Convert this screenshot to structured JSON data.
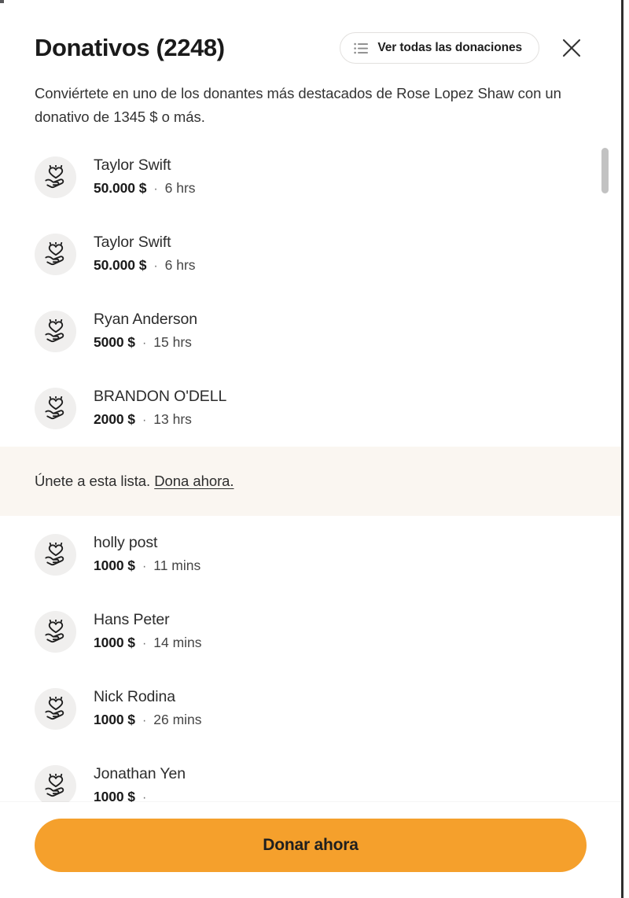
{
  "header": {
    "title": "Donativos (2248)",
    "view_all_label": "Ver todas las donaciones",
    "view_all_icon": "list-icon",
    "close_icon": "close-icon",
    "subtitle": "Conviértete en uno de los donantes más destacados de Rose Lopez Shaw con un donativo de 1345 $ o más."
  },
  "donations": [
    {
      "name": "Taylor Swift",
      "amount": "50.000 $",
      "separator": "·",
      "time": "6 hrs",
      "avatar_icon": "heart-hand-icon"
    },
    {
      "name": "Taylor Swift",
      "amount": "50.000 $",
      "separator": "·",
      "time": "6 hrs",
      "avatar_icon": "heart-hand-icon"
    },
    {
      "name": "Ryan Anderson",
      "amount": "5000 $",
      "separator": "·",
      "time": "15 hrs",
      "avatar_icon": "heart-hand-icon"
    },
    {
      "name": "BRANDON O'DELL",
      "amount": "2000 $",
      "separator": "·",
      "time": "13 hrs",
      "avatar_icon": "heart-hand-icon"
    }
  ],
  "join_banner": {
    "text": "Únete a esta lista.",
    "link_label": "Dona ahora."
  },
  "donations_after": [
    {
      "name": "holly post",
      "amount": "1000 $",
      "separator": "·",
      "time": "11 mins",
      "avatar_icon": "heart-hand-icon"
    },
    {
      "name": "Hans Peter",
      "amount": "1000 $",
      "separator": "·",
      "time": "14 mins",
      "avatar_icon": "heart-hand-icon"
    },
    {
      "name": "Nick Rodina",
      "amount": "1000 $",
      "separator": "·",
      "time": "26 mins",
      "avatar_icon": "heart-hand-icon"
    },
    {
      "name": "Jonathan Yen",
      "amount": "1000 $",
      "separator": "·",
      "time": "",
      "avatar_icon": "heart-hand-icon"
    }
  ],
  "cta": {
    "label": "Donar ahora"
  },
  "colors": {
    "accent": "#f5a02c",
    "banner_bg": "#faf6f1",
    "avatar_bg": "#f0efee",
    "text_primary": "#1a1a1a",
    "text_secondary": "#454545",
    "scrollbar_thumb": "#c2c2c2"
  },
  "scrollbar": {
    "visible": true
  }
}
